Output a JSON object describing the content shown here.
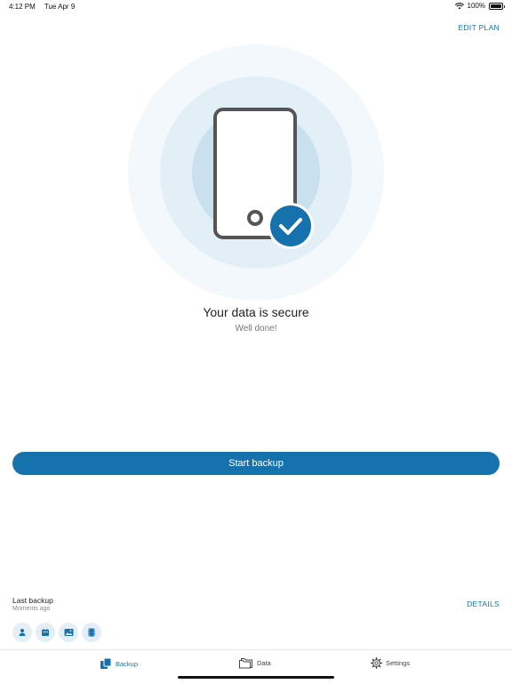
{
  "status_bar": {
    "time": "4:12 PM",
    "date": "Tue Apr 9",
    "battery": "100%"
  },
  "header": {
    "edit_plan": "EDIT PLAN"
  },
  "status": {
    "title": "Your data is secure",
    "subtitle": "Well done!"
  },
  "actions": {
    "start_backup": "Start backup"
  },
  "last_backup": {
    "title": "Last backup",
    "time": "Moments ago",
    "details": "DETAILS"
  },
  "categories": [
    "contacts-icon",
    "calendar-icon",
    "photos-icon",
    "videos-icon"
  ],
  "tabs": [
    {
      "label": "Backup",
      "icon": "backup-icon",
      "active": true
    },
    {
      "label": "Data",
      "icon": "folder-icon",
      "active": false
    },
    {
      "label": "Settings",
      "icon": "gear-icon",
      "active": false
    }
  ],
  "colors": {
    "accent": "#1672ad",
    "ring_outer": "#f2f8fc",
    "ring_mid": "#e2eff7",
    "ring_inner": "#c9e0ef",
    "phone_stroke": "#555555"
  }
}
